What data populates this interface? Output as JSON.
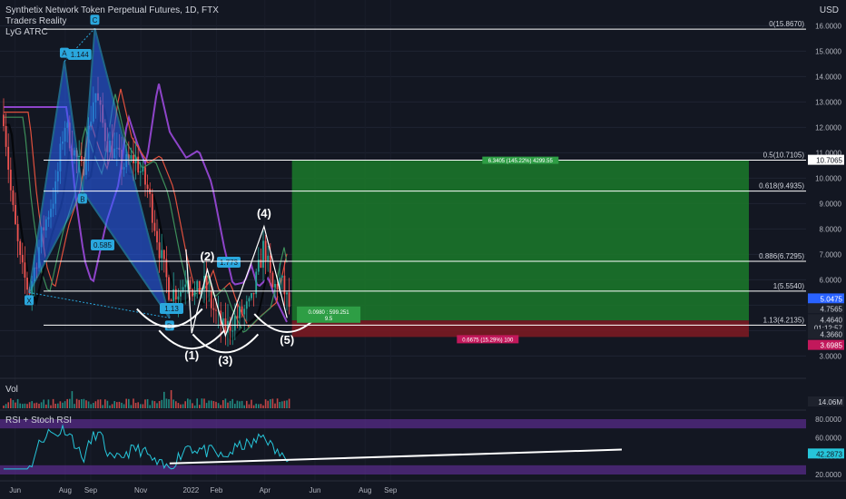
{
  "header": {
    "symbol_line": "Synthetix Network Token Perpetual Futures, 1D, FTX",
    "indicator_1": "Traders Reality",
    "indicator_2": "LyG ATRC",
    "currency": "USD"
  },
  "panes": {
    "volume_label": "Vol",
    "rsi_label": "RSI + Stoch RSI"
  },
  "colors": {
    "background": "#131722",
    "pattern_fill": "#2962ff",
    "pattern_line": "#2aa7dd",
    "fib_line": "#ffffff",
    "target_zone": "#1b7a2a",
    "stop_zone": "#7a1a22",
    "ma_purple": "#8e44c9",
    "ma_red": "#e0503d",
    "ma_green": "#3d8f5a",
    "ma_black": "#05070b",
    "rsi_line": "#26c6da",
    "rsi_band": "#5b2c8f"
  },
  "chart_data": [
    {
      "type": "candlestick",
      "title": "Synthetix Network Token Perpetual Futures, 1D, FTX",
      "x_ticks": [
        "Jun",
        "Aug",
        "Sep",
        "Nov",
        "2022",
        "Feb",
        "Apr",
        "Jun",
        "Aug",
        "Sep"
      ],
      "y_ticks": [
        "16.0000",
        "15.0000",
        "14.0000",
        "13.0000",
        "12.0000",
        "11.0000",
        "10.0000",
        "9.0000",
        "8.0000",
        "7.0000",
        "6.0000",
        "3.0000"
      ],
      "ylim": [
        2.8,
        16.8
      ],
      "fib_levels": [
        {
          "label": "0(15.8670)",
          "value": 15.867
        },
        {
          "label": "0.5(10.7105)",
          "value": 10.7105
        },
        {
          "label": "0.618(9.4935)",
          "value": 9.4935
        },
        {
          "label": "0.886(6.7295)",
          "value": 6.7295
        },
        {
          "label": "1(5.5540)",
          "value": 5.554
        },
        {
          "label": "1.13(4.2135)",
          "value": 4.2135
        }
      ],
      "harmonic_points": [
        {
          "label": "X",
          "date": "2021-06-18",
          "value": 5.5
        },
        {
          "label": "A",
          "date": "2021-07-31",
          "value": 14.6
        },
        {
          "label": "B",
          "date": "2021-08-22",
          "value": 9.5
        },
        {
          "label": "C",
          "date": "2021-09-06",
          "value": 15.9
        },
        {
          "label": "D",
          "date": "2021-12-06",
          "value": 4.5
        }
      ],
      "harmonic_ratios": [
        "1.144",
        "0.585",
        "1.773",
        "1.13"
      ],
      "wave_labels": [
        {
          "label": "(1)",
          "date": "2022-01-02",
          "value": 3.8
        },
        {
          "label": "(2)",
          "date": "2022-01-21",
          "value": 6.4
        },
        {
          "label": "(3)",
          "date": "2022-02-12",
          "value": 3.6
        },
        {
          "label": "(4)",
          "date": "2022-03-31",
          "value": 8.1
        },
        {
          "label": "(5)",
          "date": "2022-04-28",
          "value": 4.4
        }
      ],
      "price_labels": [
        {
          "text": "10.7065",
          "value": 10.7065,
          "color": "#ffffff",
          "text_color": "#131722"
        },
        {
          "text": "5.0475",
          "value": 5.25,
          "color": "#2962ff",
          "text_color": "#ffffff"
        },
        {
          "text": "4.7565",
          "value": 4.86,
          "color": "#1e222d",
          "text_color": "#d1d4dc"
        },
        {
          "text": "4.4640",
          "value": 4.43,
          "color": "#1e222d",
          "text_color": "#d1d4dc"
        },
        {
          "text": "01:12:57",
          "value": 4.1,
          "color": "#1e222d",
          "text_color": "#d1d4dc"
        },
        {
          "text": "4.3660",
          "value": 3.85,
          "color": "#1e222d",
          "text_color": "#d1d4dc"
        },
        {
          "text": "3.6985",
          "value": 3.42,
          "color": "#c2185b",
          "text_color": "#ffffff"
        }
      ],
      "position": {
        "target_label": "6.3405 (145.22%) 4299.55",
        "stats_label_1": "0.0980 : 599.251",
        "stats_label_2": "9.5",
        "stop_label": "0.6675 (15.29%) 100"
      }
    },
    {
      "type": "bar",
      "title": "Vol",
      "price_labels": [
        "14.06M"
      ]
    },
    {
      "type": "line",
      "title": "RSI + Stoch RSI",
      "y_ticks": [
        "80.0000",
        "60.0000",
        "40.0000",
        "20.0000"
      ],
      "ylim": [
        20,
        80
      ],
      "current_value": "42.2873"
    }
  ]
}
